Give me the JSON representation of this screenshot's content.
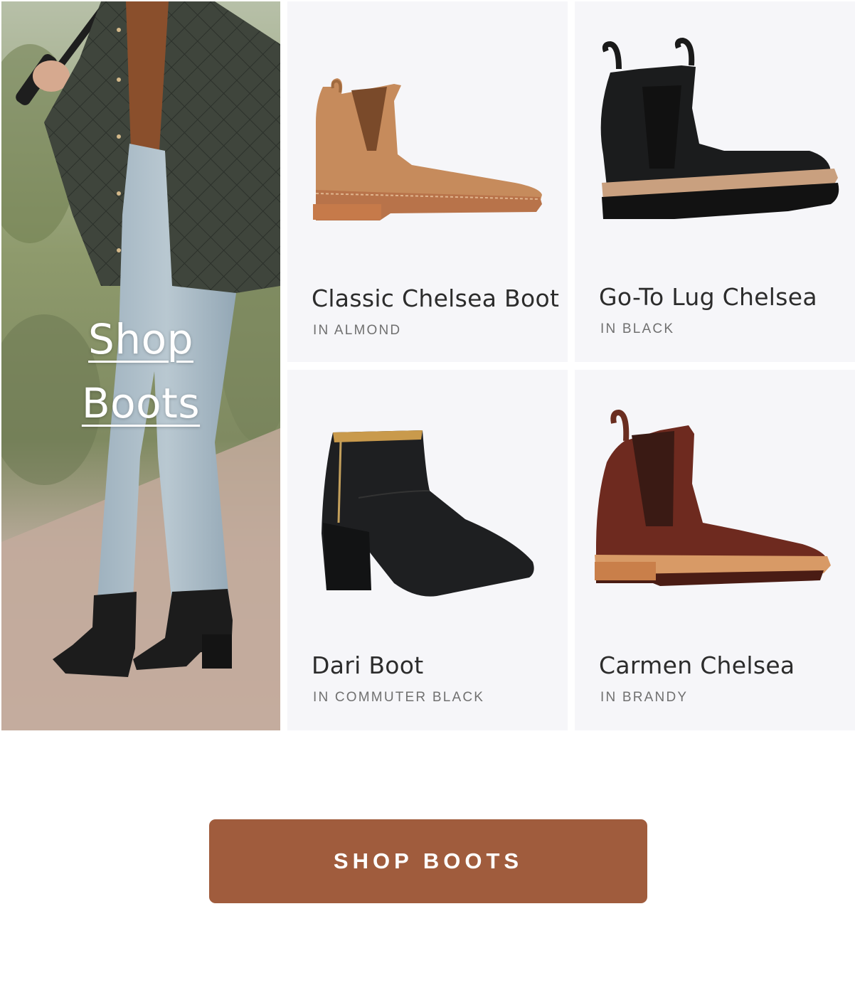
{
  "hero": {
    "line1": "Shop",
    "line2": "Boots"
  },
  "products": [
    {
      "name": "Classic Chelsea Boot",
      "color": "IN ALMOND",
      "icon": "almond-chelsea-boot-image"
    },
    {
      "name": "Go-To Lug Chelsea",
      "color": "IN BLACK",
      "icon": "black-lug-chelsea-image"
    },
    {
      "name": "Dari Boot",
      "color": "IN COMMUTER BLACK",
      "icon": "black-heeled-boot-image"
    },
    {
      "name": "Carmen Chelsea",
      "color": "IN BRANDY",
      "icon": "brandy-chelsea-boot-image"
    }
  ],
  "cta": {
    "label": "SHOP BOOTS"
  },
  "colors": {
    "cta_bg": "#a05c3d",
    "card_bg": "#f6f6f9",
    "text": "#2c2c2c",
    "subtext": "#707070"
  }
}
